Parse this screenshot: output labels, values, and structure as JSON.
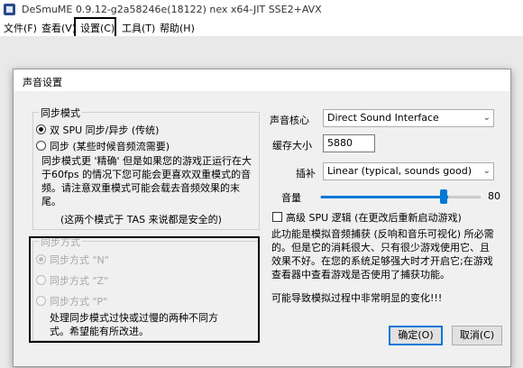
{
  "window": {
    "title": "DeSmuME 0.9.12-g2a58246e(18122) nex x64-JIT SSE2+AVX"
  },
  "menu": {
    "items": [
      "文件(F)",
      "查看(V)",
      "设置(C)",
      "工具(T)",
      "帮助(H)"
    ]
  },
  "dialog": {
    "title": "声音设置",
    "sync_mode": {
      "title": "同步模式",
      "options": [
        "双 SPU 同步/异步 (传统)",
        "同步 (某些时候音频流需要)"
      ],
      "selected": 0,
      "description": "同步模式更 '精确' 但是如果您的游戏正运行在大于60fps 的情况下您可能会更喜欢双重模式的音频。请注意双重模式可能会载去音频效果的末尾。",
      "tas_note": "(这两个模式于 TAS 来说都是安全的)"
    },
    "sync_method": {
      "title": "同步方式",
      "options": [
        "同步方式 \"N\"",
        "同步方式 \"Z\"",
        "同步方式 \"P\""
      ],
      "selected": 0,
      "note": "处理同步模式过快或过慢的两种不同方式。希望能有所改进。"
    },
    "sound_core": {
      "label": "声音核心",
      "value": "Direct Sound Interface"
    },
    "buffer_size": {
      "label": "缓存大小",
      "value": "5880"
    },
    "interpolation": {
      "label": "插补",
      "value": "Linear (typical, sounds good)"
    },
    "volume": {
      "label": "音量",
      "value": "80",
      "level": 0.8
    },
    "advanced": {
      "label": "高级 SPU 逻辑 (在更改后重新启动游戏)",
      "checked": false,
      "description": "此功能是模拟音频捕获 (反响和音乐可视化) 所必需的。但是它的消耗很大、只有很少游戏使用它、且效果不好。在您的系统足够强大时才开启它;在游戏查看器中查看游戏是否使用了捕获功能。",
      "warning": "可能导致模拟过程中非常明显的变化!!!"
    },
    "buttons": {
      "ok": "确定(O)",
      "cancel": "取消(C)"
    }
  }
}
